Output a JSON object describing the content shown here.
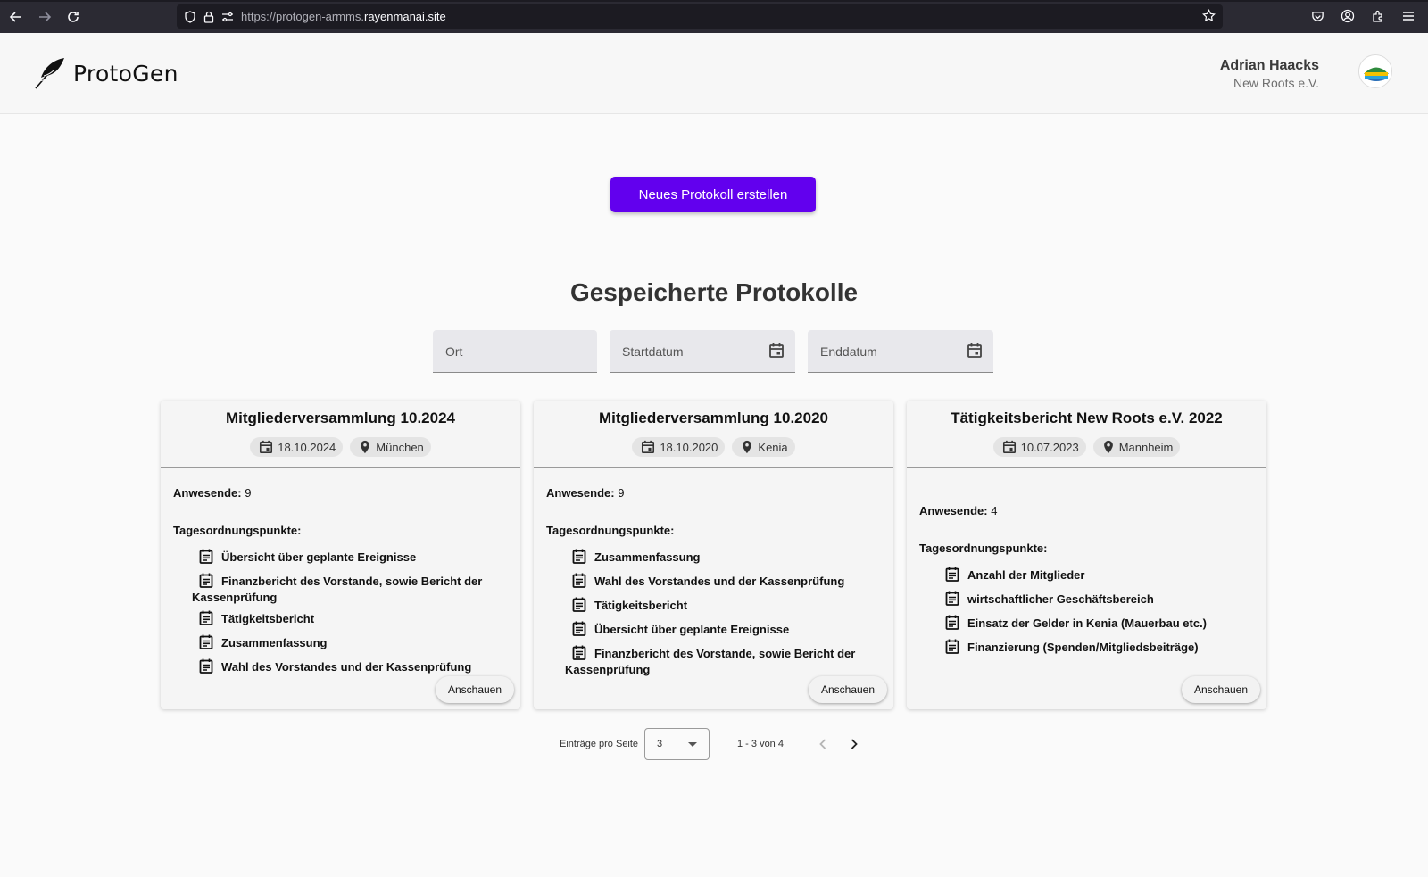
{
  "browser": {
    "url_prefix": "https://protogen-armms.",
    "url_host": "rayenmanai.site"
  },
  "header": {
    "app_name": "ProtoGen",
    "user_name": "Adrian Haacks",
    "user_org": "New Roots e.V."
  },
  "main": {
    "new_button": "Neues Protokoll erstellen",
    "section_title": "Gespeicherte Protokolle",
    "filters": {
      "ort": "Ort",
      "start": "Startdatum",
      "end": "Enddatum"
    }
  },
  "cards": [
    {
      "title": "Mitgliederversammlung 10.2024",
      "date": "18.10.2024",
      "place": "München",
      "attendees_label": "Anwesende:",
      "attendees": "9",
      "agenda_label": "Tagesordnungspunkte:",
      "agenda": [
        "Übersicht über geplante Ereignisse",
        "Finanzbericht des Vorstande, sowie Bericht der Kassenprüfung",
        "Tätigkeitsbericht",
        "Zusammenfassung",
        "Wahl des Vorstandes und der Kassenprüfung"
      ],
      "button": "Anschauen"
    },
    {
      "title": "Mitgliederversammlung 10.2020",
      "date": "18.10.2020",
      "place": "Kenia",
      "attendees_label": "Anwesende:",
      "attendees": "9",
      "agenda_label": "Tagesordnungspunkte:",
      "agenda": [
        "Zusammenfassung",
        "Wahl des Vorstandes und der Kassenprüfung",
        "Tätigkeitsbericht",
        "Übersicht über geplante Ereignisse",
        "Finanzbericht des Vorstande, sowie Bericht der Kassenprüfung"
      ],
      "button": "Anschauen"
    },
    {
      "title": "Tätigkeitsbericht New Roots e.V. 2022",
      "date": "10.07.2023",
      "place": "Mannheim",
      "attendees_label": "Anwesende:",
      "attendees": "4",
      "agenda_label": "Tagesordnungspunkte:",
      "agenda": [
        "Anzahl der Mitglieder",
        "wirtschaftlicher Geschäftsbereich",
        "Einsatz der Gelder in Kenia (Mauerbau etc.)",
        "Finanzierung (Spenden/Mitgliedsbeiträge)"
      ],
      "button": "Anschauen"
    }
  ],
  "pagination": {
    "per_page_label": "Einträge pro Seite",
    "per_page_value": "3",
    "range": "1 - 3 von 4"
  },
  "colors": {
    "primary": "#6200ee"
  }
}
